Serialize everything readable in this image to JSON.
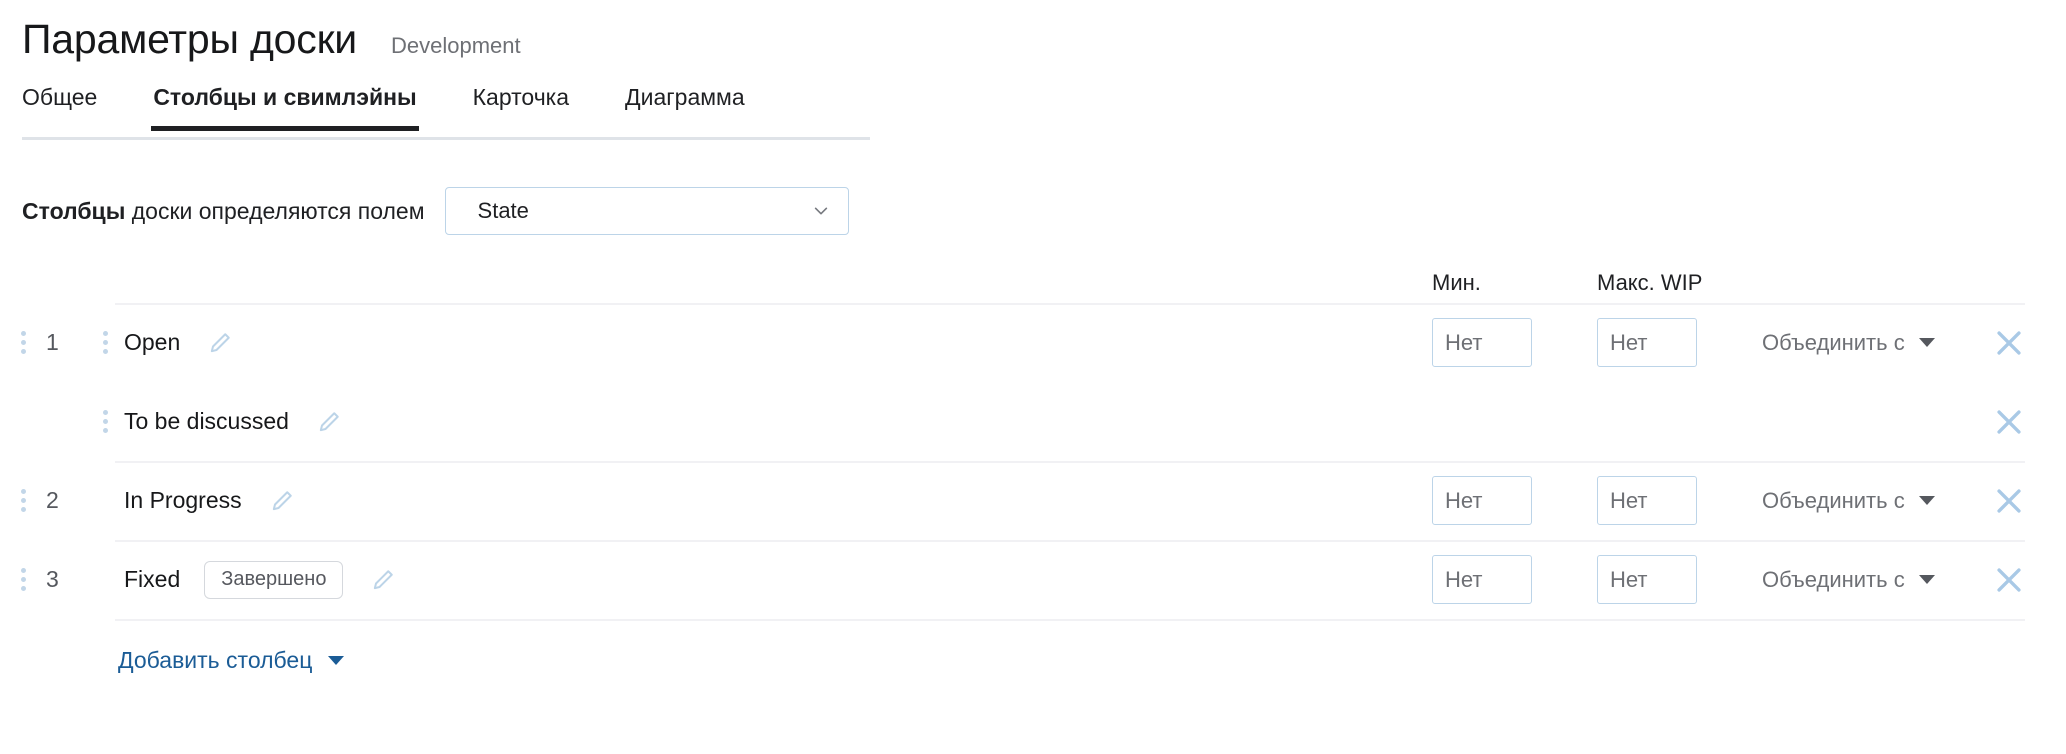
{
  "header": {
    "title": "Параметры доски",
    "breadcrumb": "Development"
  },
  "tabs": [
    {
      "label": "Общее",
      "active": false
    },
    {
      "label": "Столбцы и свимлэйны",
      "active": true
    },
    {
      "label": "Карточка",
      "active": false
    },
    {
      "label": "Диаграмма",
      "active": false
    }
  ],
  "field_row": {
    "label_bold": "Столбцы",
    "label_rest": " доски определяются полем",
    "select_value": "State",
    "select_icon": "chevron-down-icon"
  },
  "table": {
    "headers": {
      "min": "Мин.",
      "max": "Макс. WIP"
    },
    "placeholders": {
      "min": "Нет",
      "max": "Нет"
    },
    "merge_label": "Объединить с",
    "rows": [
      {
        "index": "1",
        "name": "Open",
        "badge": "",
        "min": "",
        "max": "",
        "merge": "Объединить с",
        "sub": false,
        "has_controls": true
      },
      {
        "index": "",
        "name": "To be discussed",
        "badge": "",
        "min": "",
        "max": "",
        "merge": "",
        "sub": true,
        "has_controls": false
      },
      {
        "index": "2",
        "name": "In Progress",
        "badge": "",
        "min": "",
        "max": "",
        "merge": "Объединить с",
        "sub": false,
        "has_controls": true
      },
      {
        "index": "3",
        "name": "Fixed",
        "badge": "Завершено",
        "min": "",
        "max": "",
        "merge": "Объединить с",
        "sub": false,
        "has_controls": true
      }
    ]
  },
  "add_column": {
    "label": "Добавить столбец",
    "icon": "caret-down-icon"
  },
  "colors": {
    "accent_link": "#1b5c96",
    "input_border": "#bcd4e8",
    "icon_blue": "#a9c9e6",
    "divider": "#f1f1f4",
    "text_muted": "#6e7075",
    "tab_underline": "#1f2023"
  }
}
